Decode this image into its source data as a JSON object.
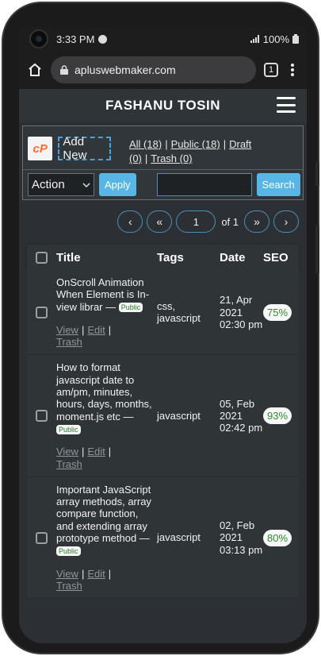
{
  "status_bar": {
    "time": "3:33 PM",
    "battery": "100%"
  },
  "browser": {
    "url": "apluswebmaker.com",
    "tab_count": "1"
  },
  "site": {
    "title": "FASHANU TOSIN"
  },
  "toolbar": {
    "add_new": "Add New",
    "filters": {
      "all": "All (18)",
      "public": "Public (18)",
      "draft": "Draft (0)",
      "trash": "Trash (0)",
      "separator": "|"
    },
    "action_select": "Action",
    "apply": "Apply",
    "search": "Search"
  },
  "pagination": {
    "prev": "‹",
    "first": "«",
    "current": "1",
    "of_label": "of 1",
    "last": "»",
    "next": "›"
  },
  "table": {
    "headers": {
      "title": "Title",
      "tags": "Tags",
      "date": "Date",
      "seo": "SEO"
    },
    "rows": [
      {
        "title": "OnScroll Animation When Element is In-view librar —",
        "status": "Public",
        "tags": "css, javascript",
        "date": "21, Apr 2021 02:30 pm",
        "seo": "75%",
        "actions": {
          "view": "View",
          "edit": "Edit",
          "trash": "Trash"
        }
      },
      {
        "title": "How to format javascript date to am/pm, minutes, hours, days, months, moment.js etc —",
        "status": "Public",
        "tags": "javascript",
        "date": "05, Feb 2021 02:42 pm",
        "seo": "93%",
        "actions": {
          "view": "View",
          "edit": "Edit",
          "trash": "Trash"
        }
      },
      {
        "title": "Important JavaScript array methods, array compare function, and extending array prototype method —",
        "status": "Public",
        "tags": "javascript",
        "date": "02, Feb 2021 03:13 pm",
        "seo": "80%",
        "actions": {
          "view": "View",
          "edit": "Edit",
          "trash": "Trash"
        }
      }
    ]
  },
  "colors": {
    "accent": "#57b6e6",
    "seo_green": "#2e8b2e",
    "page_bg": "#2c3034"
  }
}
